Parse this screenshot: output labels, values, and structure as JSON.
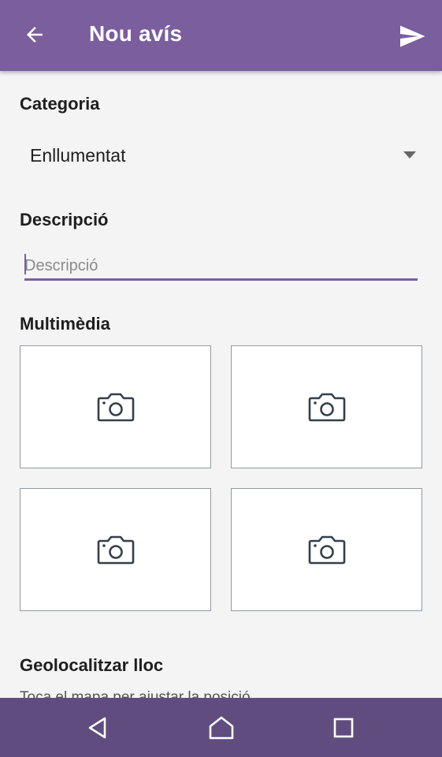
{
  "header": {
    "title": "Nou avís",
    "back_icon": "arrow-left-icon",
    "send_icon": "send-icon",
    "background": "#7a5e9e"
  },
  "category": {
    "label": "Categoria",
    "selected": "Enllumentat"
  },
  "description": {
    "label": "Descripció",
    "value": "",
    "placeholder": "Descripció",
    "accent": "#7a5e9e"
  },
  "multimedia": {
    "label": "Multimèdia",
    "slots": [
      {
        "icon": "camera-icon"
      },
      {
        "icon": "camera-icon"
      },
      {
        "icon": "camera-icon"
      },
      {
        "icon": "camera-icon"
      }
    ]
  },
  "geolocation": {
    "label": "Geolocalitzar lloc",
    "hint": "Toca el mapa per ajustar la posició"
  },
  "navbar": {
    "background": "#614c80",
    "buttons": [
      "back-triangle-icon",
      "home-icon",
      "recents-square-icon"
    ]
  }
}
